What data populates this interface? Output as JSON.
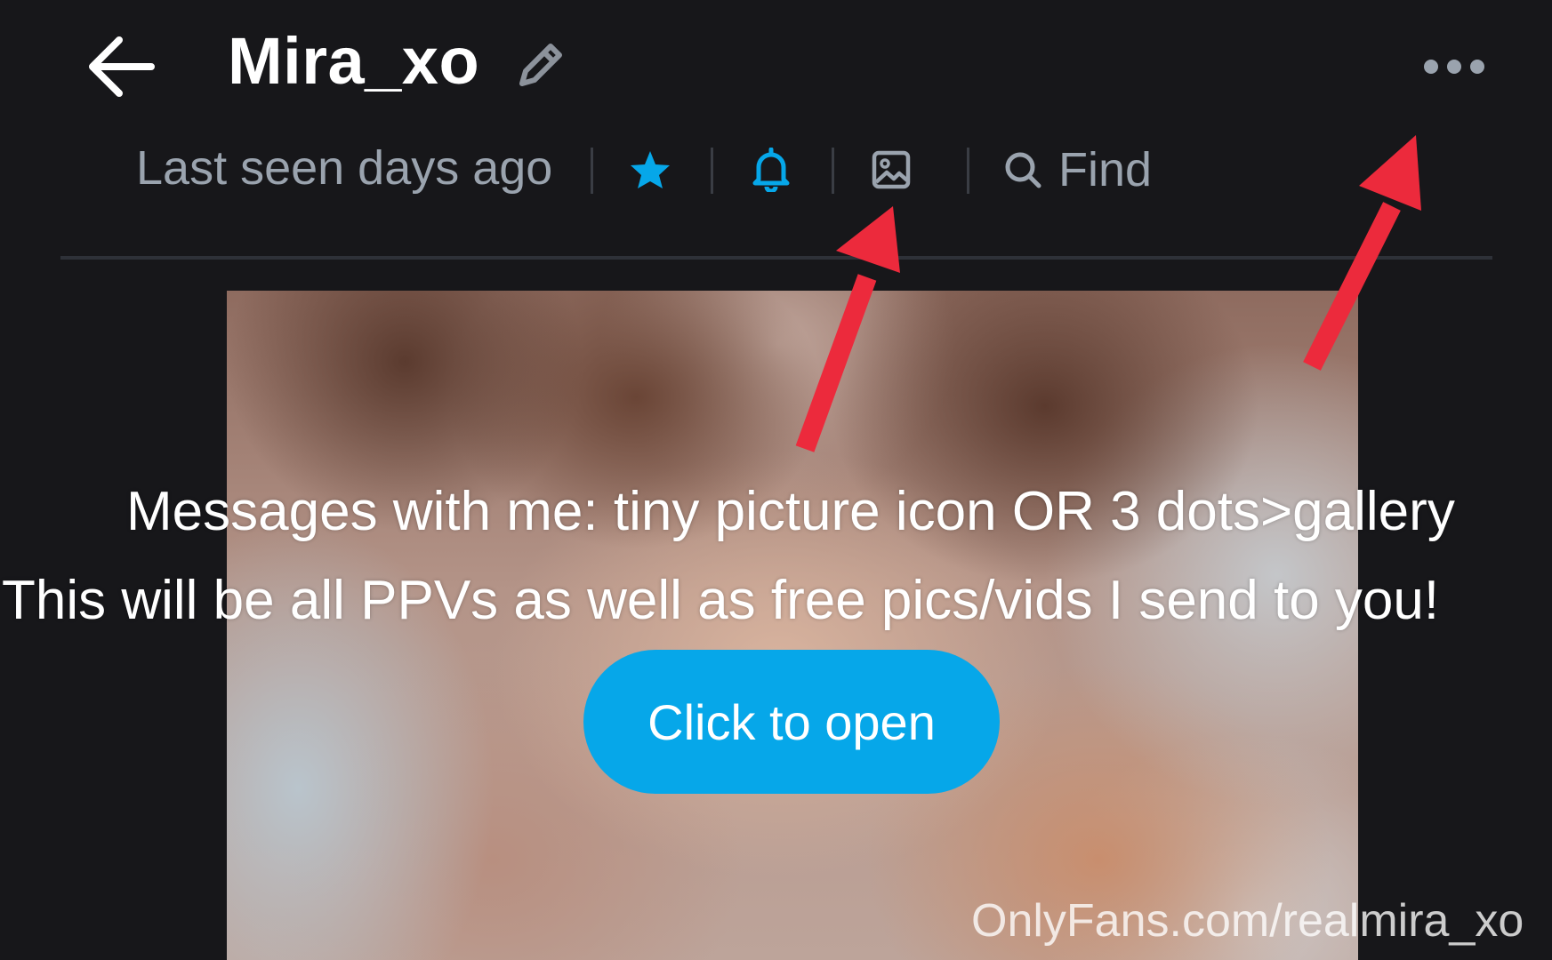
{
  "header": {
    "title": "Mira_xo",
    "back_icon": "arrow-left-icon",
    "edit_icon": "pencil-icon",
    "more_icon": "more-horizontal-icon"
  },
  "subbar": {
    "last_seen": "Last seen days ago",
    "find_label": "Find",
    "icons": [
      "star-icon",
      "bell-icon",
      "image-icon",
      "search-icon"
    ]
  },
  "media": {
    "line1": "Messages with me: tiny picture icon OR 3 dots>gallery",
    "line2": "This will be all PPVs as well as free pics/vids I send to you!",
    "open_button": "Click to open",
    "watermark": "OnlyFans.com/realmira_xo"
  },
  "colors": {
    "background": "#17171a",
    "accent": "#06a7e9",
    "muted_text": "#9aa3ae",
    "annotation_arrow": "#ec2a3c"
  }
}
